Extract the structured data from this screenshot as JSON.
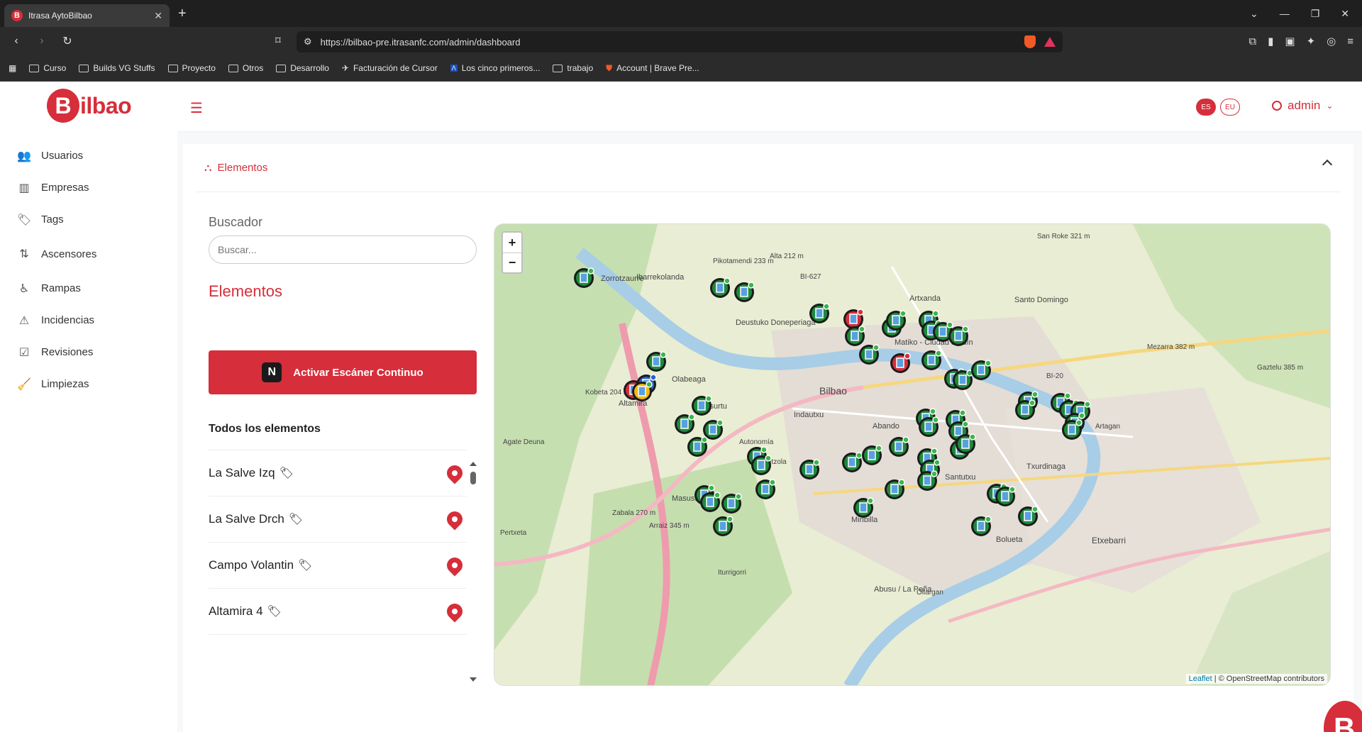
{
  "browser": {
    "tab_title": "Itrasa AytoBilbao",
    "favicon_letter": "B",
    "url": "https://bilbao-pre.itrasanfc.com/admin/dashboard",
    "bookmarks": [
      "Curso",
      "Builds VG Stuffs",
      "Proyecto",
      "Otros",
      "Desarrollo",
      "Facturación de Cursor",
      "Los cinco primeros...",
      "trabajo",
      "Account | Brave Pre..."
    ]
  },
  "header": {
    "logo_letter": "B",
    "logo_text": "ilbao",
    "lang_es": "ES",
    "lang_eu": "EU",
    "user": "admin"
  },
  "sidebar": {
    "items": [
      {
        "label": "Usuarios",
        "icon": "users-icon"
      },
      {
        "label": "Empresas",
        "icon": "building-icon"
      },
      {
        "label": "Tags",
        "icon": "tags-icon"
      },
      {
        "label": "Ascensores",
        "icon": "elevator-icon"
      },
      {
        "label": "Rampas",
        "icon": "ramp-icon"
      },
      {
        "label": "Incidencias",
        "icon": "warning-icon"
      },
      {
        "label": "Revisiones",
        "icon": "clipboard-check-icon"
      },
      {
        "label": "Limpiezas",
        "icon": "broom-icon"
      }
    ]
  },
  "main": {
    "card_title": "Elementos",
    "search_label": "Buscador",
    "search_placeholder": "Buscar...",
    "section_title": "Elementos",
    "scan_button": "Activar Escáner Continuo",
    "list_header": "Todos los elementos",
    "elements": [
      "La Salve Izq",
      "La Salve Drch",
      "Campo Volantin",
      "Altamira 4"
    ]
  },
  "map": {
    "zoom_in": "+",
    "zoom_out": "−",
    "attribution_leaflet": "Leaflet",
    "attribution_rest": " | © OpenStreetMap contributors",
    "labels": [
      "Bilbao",
      "Olabeaga",
      "Basurtu",
      "Indautxu",
      "Abando",
      "Santutxu",
      "Txurdinaga",
      "Bolueta",
      "Etxebarri",
      "Zorrotzaurre",
      "Ibarrekolanda",
      "Deustuko Doneperiaga",
      "Altamira",
      "Masustegi",
      "Santo Domingo",
      "Artxanda",
      "Matiko - Ciudad Jardín",
      "Miribilla",
      "Abusu / La Peña",
      "Agate Deuna",
      "Kobeta 204 m",
      "Pertxeta",
      "Zabala 270 m",
      "Arraiz 345 m",
      "Pikotamendi 233 m",
      "San Roke 321 m",
      "Alta 212 m",
      "Ametzola",
      "Autonomía",
      "Artagan",
      "Ollargan",
      "Iturrigorri",
      "Mezarra 382 m",
      "Gaztelu 385 m",
      "BI-627",
      "BI-20"
    ],
    "marker_colors": {
      "green": "#1e8a3c",
      "red": "#d62e3a",
      "blue": "#2a62c9",
      "yellow": "#f2b90d"
    }
  }
}
